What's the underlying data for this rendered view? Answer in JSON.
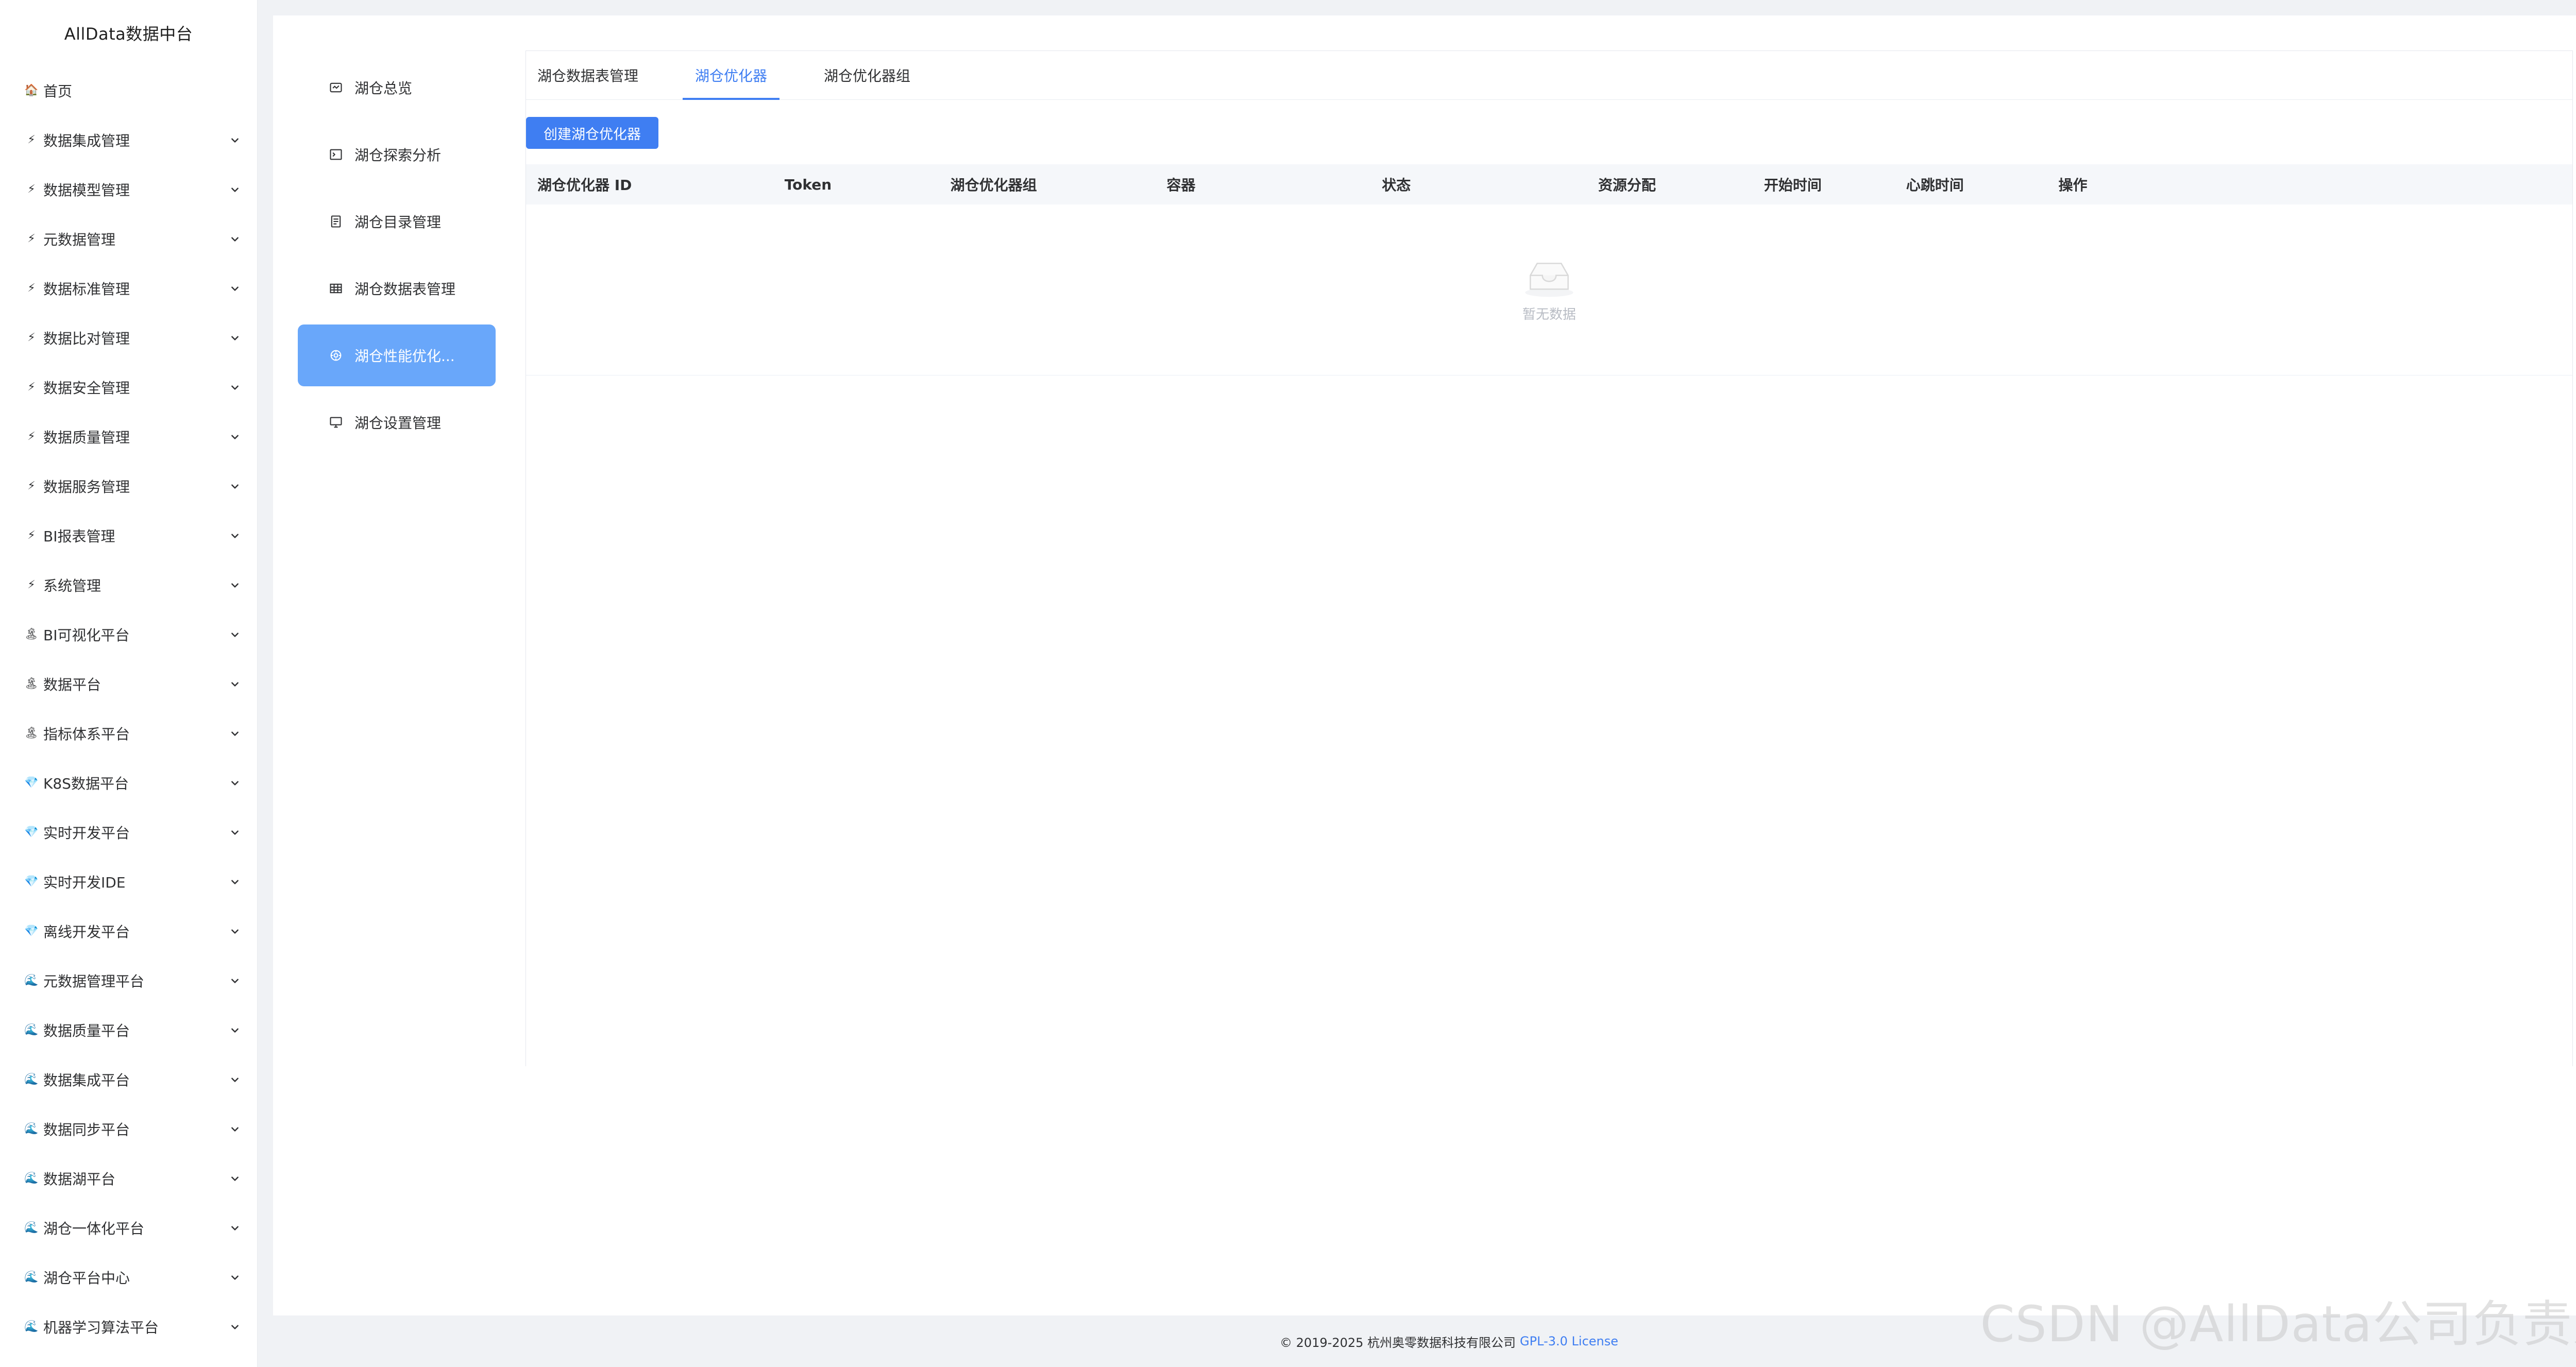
{
  "brand": {
    "title": "AllData数据中台"
  },
  "sidebar": {
    "items": [
      {
        "icon": "🏠",
        "icon_name": "home-icon",
        "label": "首页",
        "has_children": false
      },
      {
        "icon": "⚡",
        "icon_name": "lightning-icon",
        "label": "数据集成管理",
        "has_children": true
      },
      {
        "icon": "⚡",
        "icon_name": "lightning-icon",
        "label": "数据模型管理",
        "has_children": true
      },
      {
        "icon": "⚡",
        "icon_name": "lightning-icon",
        "label": "元数据管理",
        "has_children": true
      },
      {
        "icon": "⚡",
        "icon_name": "lightning-icon",
        "label": "数据标准管理",
        "has_children": true
      },
      {
        "icon": "⚡",
        "icon_name": "lightning-icon",
        "label": "数据比对管理",
        "has_children": true
      },
      {
        "icon": "⚡",
        "icon_name": "lightning-icon",
        "label": "数据安全管理",
        "has_children": true
      },
      {
        "icon": "⚡",
        "icon_name": "lightning-icon",
        "label": "数据质量管理",
        "has_children": true
      },
      {
        "icon": "⚡",
        "icon_name": "lightning-icon",
        "label": "数据服务管理",
        "has_children": true
      },
      {
        "icon": "⚡",
        "icon_name": "lightning-icon",
        "label": "BI报表管理",
        "has_children": true
      },
      {
        "icon": "⚡",
        "icon_name": "lightning-icon",
        "label": "系统管理",
        "has_children": true
      },
      {
        "icon": "🏝",
        "icon_name": "island-icon",
        "label": "BI可视化平台",
        "has_children": true
      },
      {
        "icon": "🏝",
        "icon_name": "island-icon",
        "label": "数据平台",
        "has_children": true
      },
      {
        "icon": "🏝",
        "icon_name": "island-icon",
        "label": "指标体系平台",
        "has_children": true
      },
      {
        "icon": "💎",
        "icon_name": "gem-icon",
        "label": "K8S数据平台",
        "has_children": true
      },
      {
        "icon": "💎",
        "icon_name": "gem-icon",
        "label": "实时开发平台",
        "has_children": true
      },
      {
        "icon": "💎",
        "icon_name": "gem-icon",
        "label": "实时开发IDE",
        "has_children": true
      },
      {
        "icon": "💎",
        "icon_name": "gem-icon",
        "label": "离线开发平台",
        "has_children": true
      },
      {
        "icon": "🌊",
        "icon_name": "wave-icon",
        "label": "元数据管理平台",
        "has_children": true
      },
      {
        "icon": "🌊",
        "icon_name": "wave-icon",
        "label": "数据质量平台",
        "has_children": true
      },
      {
        "icon": "🌊",
        "icon_name": "wave-icon",
        "label": "数据集成平台",
        "has_children": true
      },
      {
        "icon": "🌊",
        "icon_name": "wave-icon",
        "label": "数据同步平台",
        "has_children": true
      },
      {
        "icon": "🌊",
        "icon_name": "wave-icon",
        "label": "数据湖平台",
        "has_children": true
      },
      {
        "icon": "🌊",
        "icon_name": "wave-icon",
        "label": "湖仓一体化平台",
        "has_children": true
      },
      {
        "icon": "🌊",
        "icon_name": "wave-icon",
        "label": "湖仓平台中心",
        "has_children": true
      },
      {
        "icon": "🌊",
        "icon_name": "wave-icon",
        "label": "机器学习算法平台",
        "has_children": true
      }
    ]
  },
  "submenu": {
    "items": [
      {
        "label": "湖仓总览",
        "icon_name": "overview-icon",
        "active": false
      },
      {
        "label": "湖仓探索分析",
        "icon_name": "terminal-icon",
        "active": false
      },
      {
        "label": "湖仓目录管理",
        "icon_name": "catalog-icon",
        "active": false
      },
      {
        "label": "湖仓数据表管理",
        "icon_name": "table-icon",
        "active": false
      },
      {
        "label": "湖仓性能优化...",
        "icon_name": "optimize-icon",
        "active": true
      },
      {
        "label": "湖仓设置管理",
        "icon_name": "monitor-icon",
        "active": false
      }
    ]
  },
  "tabs": [
    {
      "label": "湖仓数据表管理",
      "active": false
    },
    {
      "label": "湖仓优化器",
      "active": true
    },
    {
      "label": "湖仓优化器组",
      "active": false
    }
  ],
  "toolbar": {
    "create_label": "创建湖仓优化器"
  },
  "table": {
    "columns": [
      "湖仓优化器 ID",
      "Token",
      "湖仓优化器组",
      "容器",
      "状态",
      "资源分配",
      "开始时间",
      "心跳时间",
      "操作"
    ],
    "empty_text": "暂无数据"
  },
  "footer": {
    "copyright": "© 2019-2025 杭州奥零数据科技有限公司",
    "license_link": "GPL-3.0 License"
  },
  "watermark": {
    "text": "CSDN @AllData公司负责人"
  },
  "colors": {
    "accent": "#3f7ef2",
    "active_submenu": "#69a7fa",
    "header_bg": "#f5f7fa",
    "page_bg": "#f0f2f5"
  }
}
